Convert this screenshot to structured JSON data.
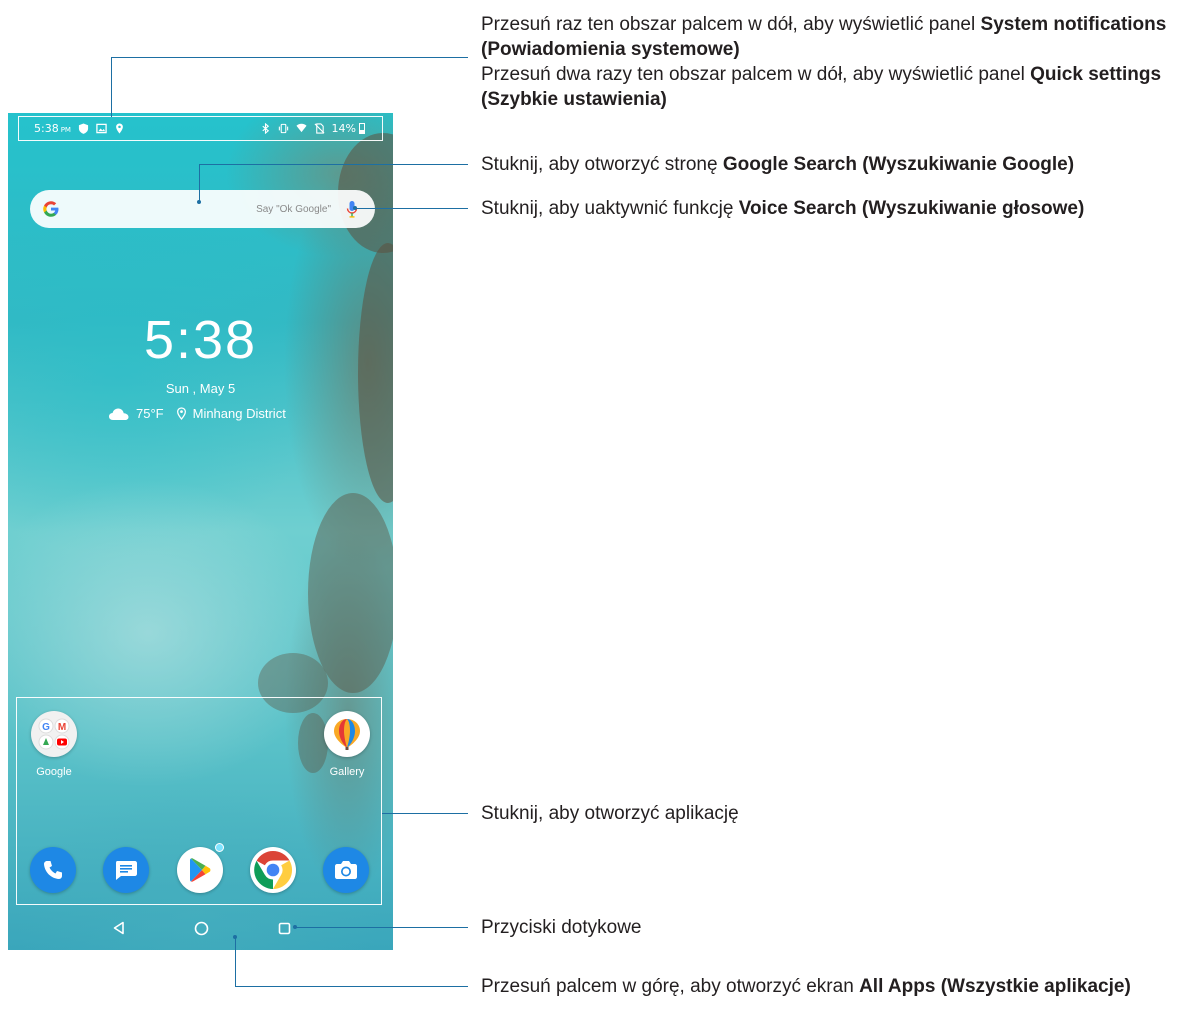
{
  "status_bar": {
    "time": "5:38",
    "ampm": "PM",
    "battery": "14%"
  },
  "search": {
    "hint": "Say \"Ok Google\""
  },
  "clock": {
    "time": "5:38",
    "date": "Sun , May 5",
    "temperature": "75°F",
    "location": "Minhang District"
  },
  "apps": {
    "google_folder": "Google",
    "gallery": "Gallery",
    "dock": [
      "phone-icon",
      "messages-icon",
      "play-store-icon",
      "chrome-icon",
      "camera-icon"
    ]
  },
  "nav": [
    "back-icon",
    "home-icon",
    "recents-icon"
  ],
  "callouts": {
    "notifications": {
      "line1_text": "Przesuń raz ten obszar palcem w dół, aby wyświetlić panel ",
      "line1_bold": "System notifications (Powiadomienia systemowe)",
      "line2_text": "Przesuń dwa razy ten obszar palcem w dół, aby wyświetlić panel ",
      "line2_bold": "Quick settings (Szybkie ustawienia)"
    },
    "google_search": {
      "text": "Stuknij, aby otworzyć stronę ",
      "bold": "Google Search (Wyszukiwanie Google)"
    },
    "voice_search": {
      "text": "Stuknij, aby uaktywnić funkcję ",
      "bold": "Voice Search (Wyszukiwanie głosowe)"
    },
    "open_app": {
      "text": "Stuknij, aby otworzyć aplikację"
    },
    "touch_buttons": {
      "text": "Przyciski dotykowe"
    },
    "all_apps": {
      "text": "Przesuń palcem w górę, aby otworzyć ekran ",
      "bold": "All Apps (Wszystkie aplikacje)"
    }
  },
  "colors": {
    "callout_line": "#1d6fa3",
    "text": "#231f20"
  }
}
